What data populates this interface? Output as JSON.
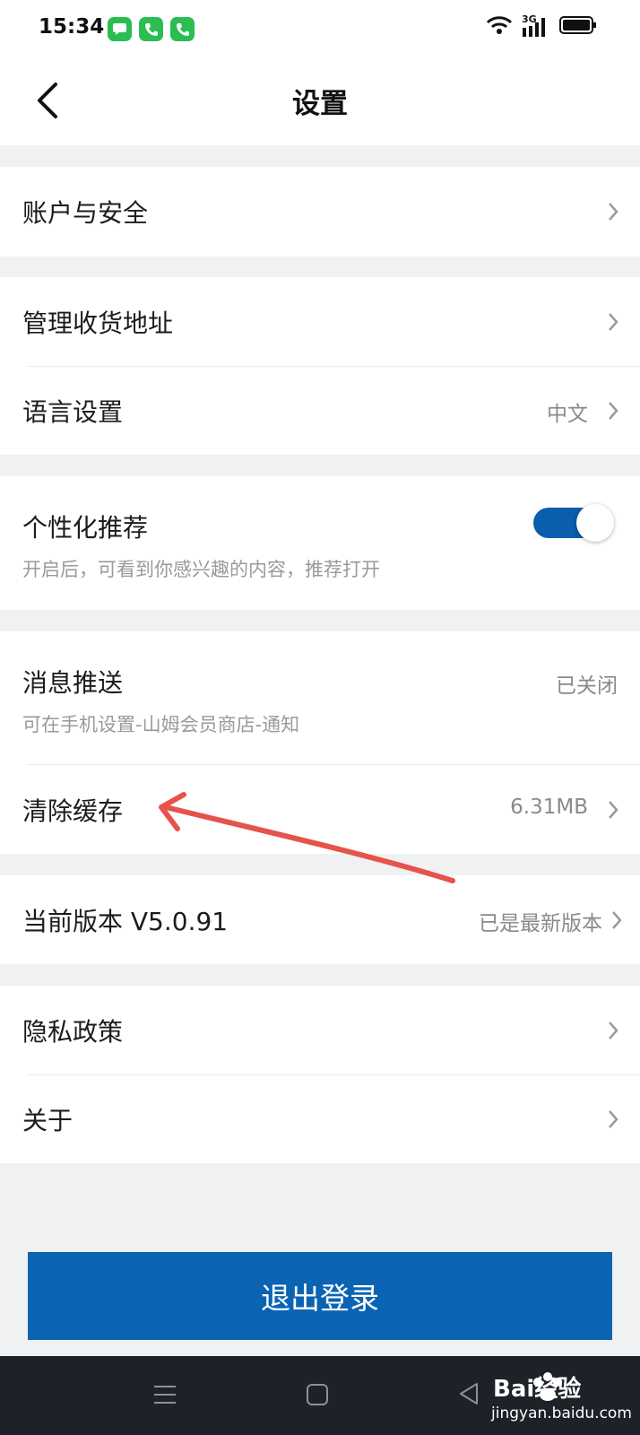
{
  "status_bar": {
    "time": "15:34",
    "notification_icons": [
      "message-icon",
      "phone-icon",
      "phone-icon"
    ],
    "network": "3G",
    "system_icons": [
      "wifi-icon",
      "signal-icon",
      "battery-icon"
    ]
  },
  "header": {
    "title": "设置",
    "back_icon": "chevron-left-icon"
  },
  "settings": {
    "account_security": {
      "label": "账户与安全"
    },
    "manage_address": {
      "label": "管理收货地址"
    },
    "language": {
      "label": "语言设置",
      "value": "中文"
    },
    "personalized": {
      "label": "个性化推荐",
      "description": "开启后，可看到你感兴趣的内容，推荐打开",
      "enabled": true
    },
    "message_push": {
      "label": "消息推送",
      "value": "已关闭",
      "description": "可在手机设置-山姆会员商店-通知"
    },
    "clear_cache": {
      "label": "清除缓存",
      "value": "6.31MB"
    },
    "version": {
      "label": "当前版本 V5.0.91",
      "value": "已是最新版本"
    },
    "privacy": {
      "label": "隐私政策"
    },
    "about": {
      "label": "关于"
    }
  },
  "logout_label": "退出登录",
  "colors": {
    "accent": "#0b64b3",
    "toggle_on": "#0b5dad",
    "annotation_arrow": "#e5534b",
    "bottom_bar": "#1d2128"
  },
  "watermark": {
    "logo_text": "Bai经验",
    "url": "jingyan.baidu.com"
  }
}
